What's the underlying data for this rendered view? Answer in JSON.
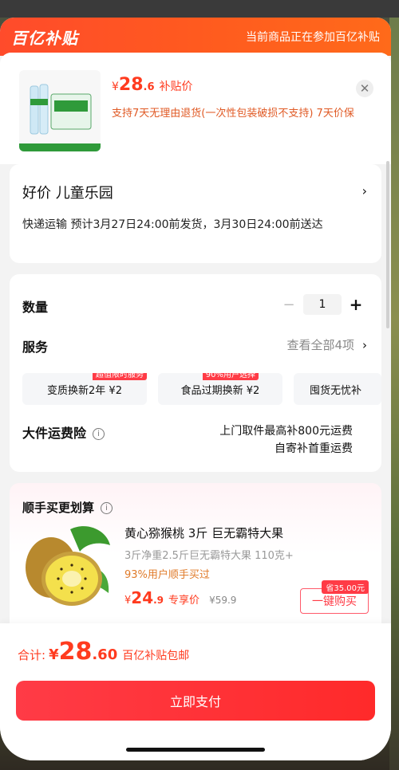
{
  "header": {
    "logo": "百亿补贴",
    "tip": "当前商品正在参加百亿补贴"
  },
  "product": {
    "price_yen": "¥",
    "price_int": "28",
    "price_dec": ".6",
    "price_tag": "补贴价",
    "return_policy": "支持7天无理由退货(一次性包装破损不支持) 7天价保",
    "close_icon": "close-icon"
  },
  "store": {
    "name": "好价 儿童乐园",
    "arrow": "›",
    "delivery": "快递运输 预计3月27日24:00前发货，3月30日24:00前送达"
  },
  "options": {
    "quantity_label": "数量",
    "minus": "−",
    "quantity": "1",
    "plus": "+",
    "service_label": "服务",
    "service_all": "查看全部4项",
    "service_chevron": "›",
    "chips": [
      {
        "label": "变质换新2年 ¥2",
        "badge": "超值限时服务"
      },
      {
        "label": "食品过期换新 ¥2",
        "badge": "90%用户选择"
      },
      {
        "label": "囤货无忧补",
        "badge": ""
      }
    ],
    "insurance_label": "大件运费险",
    "info_icon": "i",
    "insurance_line1": "上门取件最高补800元运费",
    "insurance_line2": "自寄补首重运费"
  },
  "upsell": {
    "title": "顺手买更划算",
    "info_icon": "i",
    "item_title": "黄心猕猴桃 3斤 巨无霸特大果",
    "item_spec": "3斤净重2.5斤巨无霸特大果 110克+",
    "item_pop": "93%用户顺手买过",
    "price_yen": "¥",
    "price_int": "24",
    "price_dec": ".9",
    "price_tag": "专享价",
    "orig_price": "¥59.9",
    "save_badge": "省35.00元",
    "buy_label": "一键购买"
  },
  "footer": {
    "total_label": "合计:",
    "total_yen": "¥",
    "total_int": "28",
    "total_dec": ".60",
    "total_note": "百亿补贴包邮",
    "pay_label": "立即支付"
  },
  "colors": {
    "brand": "#ff4b2b",
    "accent": "#ff3b46"
  }
}
